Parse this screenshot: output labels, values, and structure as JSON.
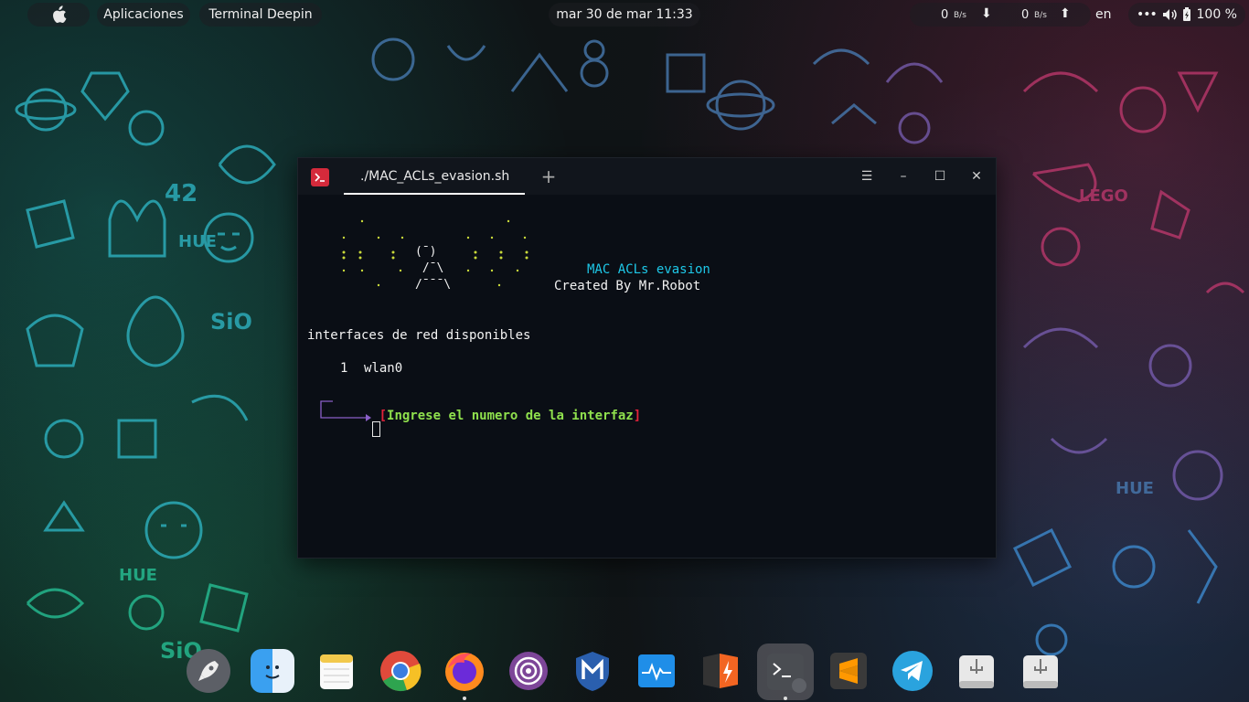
{
  "top_panel": {
    "apps_label": "Aplicaciones",
    "active_window_label": "Terminal Deepin",
    "clock": "mar 30 de mar  11:33",
    "net_down_value": "0",
    "net_down_unit": "B/s",
    "net_up_value": "0",
    "net_up_unit": "B/s",
    "keyboard_layout": "en",
    "battery": "100 %"
  },
  "terminal": {
    "tab_title": "./MAC_ACLs_evasion.sh",
    "banner_title": "MAC ACLs evasion",
    "banner_author": "Created By Mr.Robot",
    "ascii_face": "(¯)\n /¯\\\n/¯¯¯\\",
    "interfaces_heading": "interfaces de red disponibles",
    "interfaces": [
      {
        "index": "1",
        "name": "wlan0"
      }
    ],
    "prompt_open": "[",
    "prompt_text": "Ingrese el numero de la interfaz",
    "prompt_close": "]"
  },
  "dock": {
    "items": [
      "launcher-icon",
      "finder-icon",
      "notes-icon",
      "chrome-icon",
      "firefox-icon",
      "tor-browser-icon",
      "metasploit-icon",
      "system-monitor-icon",
      "burpsuite-icon",
      "terminal-icon",
      "sublime-text-icon",
      "telegram-icon",
      "usb-drive-icon",
      "usb-drive-icon"
    ]
  },
  "colors": {
    "accent_red": "#d42a3b",
    "banner_cyan": "#1ec8e8",
    "prompt_green": "#8fe04d",
    "ascii_dots": "#c9d93a"
  }
}
